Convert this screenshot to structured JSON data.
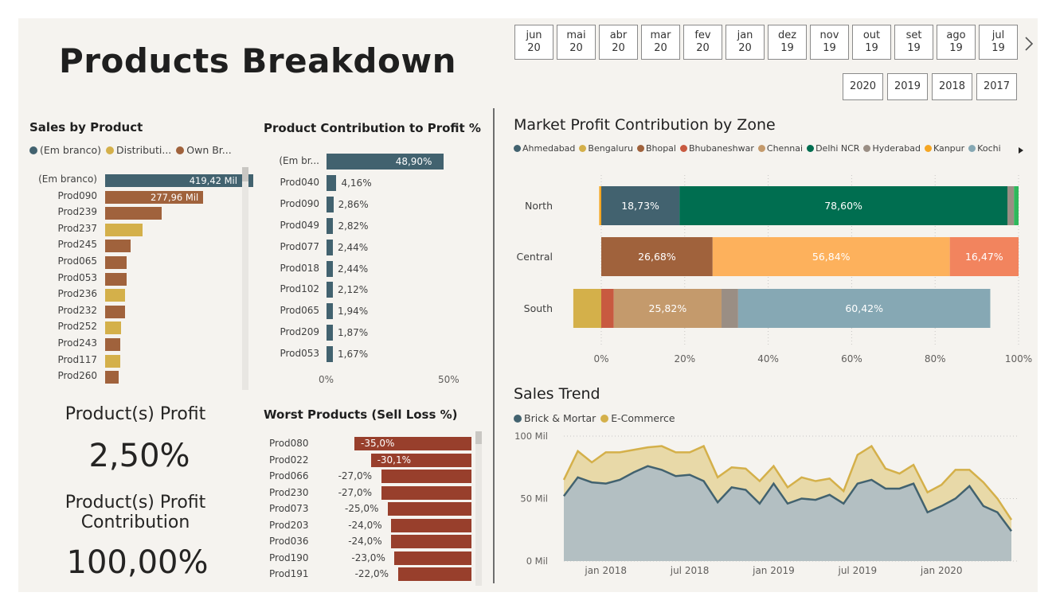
{
  "page_title": "Products Breakdown",
  "month_slicer": [
    {
      "m": "jun",
      "y": "20"
    },
    {
      "m": "mai",
      "y": "20"
    },
    {
      "m": "abr",
      "y": "20"
    },
    {
      "m": "mar",
      "y": "20"
    },
    {
      "m": "fev",
      "y": "20"
    },
    {
      "m": "jan",
      "y": "20"
    },
    {
      "m": "dez",
      "y": "19"
    },
    {
      "m": "nov",
      "y": "19"
    },
    {
      "m": "out",
      "y": "19"
    },
    {
      "m": "set",
      "y": "19"
    },
    {
      "m": "ago",
      "y": "19"
    },
    {
      "m": "jul",
      "y": "19"
    }
  ],
  "year_slicer": [
    "2020",
    "2019",
    "2018",
    "2017"
  ],
  "sales_by_product": {
    "title": "Sales by Product",
    "legend": [
      {
        "label": "(Em branco)",
        "color": "#42626f"
      },
      {
        "label": "Distributi...",
        "color": "#d4b04a"
      },
      {
        "label": "Own Br...",
        "color": "#a0623c"
      }
    ]
  },
  "profit_contribution": {
    "title": "Product Contribution to Profit %"
  },
  "worst_products": {
    "title": "Worst Products (Sell Loss %)"
  },
  "kpi": {
    "profit_label": "Product(s) Profit",
    "profit_value": "2,50%",
    "contribution_label_1": "Product(s) Profit",
    "contribution_label_2": "Contribution",
    "contribution_value": "100,00%"
  },
  "market_zone": {
    "title": "Market Profit Contribution by Zone",
    "legend": [
      {
        "label": "Ahmedabad",
        "color": "#42626f"
      },
      {
        "label": "Bengaluru",
        "color": "#d4b04a"
      },
      {
        "label": "Bhopal",
        "color": "#a0623c"
      },
      {
        "label": "Bhubaneshwar",
        "color": "#c85a40"
      },
      {
        "label": "Chennai",
        "color": "#c49a6c"
      },
      {
        "label": "Delhi NCR",
        "color": "#006e50"
      },
      {
        "label": "Hyderabad",
        "color": "#9a8e84"
      },
      {
        "label": "Kanpur",
        "color": "#f5a623"
      },
      {
        "label": "Kochi",
        "color": "#86a8b4"
      }
    ]
  },
  "sales_trend": {
    "title": "Sales Trend",
    "legend": [
      {
        "label": "Brick & Mortar",
        "color": "#42626f"
      },
      {
        "label": "E-Commerce",
        "color": "#d4b04a"
      }
    ]
  },
  "chart_data": [
    {
      "type": "bar",
      "orientation": "horizontal",
      "title": "Sales by Product",
      "categories": [
        "(Em branco)",
        "Prod090",
        "Prod239",
        "Prod237",
        "Prod245",
        "Prod065",
        "Prod053",
        "Prod236",
        "Prod232",
        "Prod252",
        "Prod243",
        "Prod117",
        "Prod260"
      ],
      "values": [
        419.42,
        277.96,
        160,
        107,
        72,
        62,
        62,
        56,
        56,
        46,
        42,
        42,
        38
      ],
      "groups": [
        "(Em branco)",
        "Own Br...",
        "Own Br...",
        "Distributi...",
        "Own Br...",
        "Own Br...",
        "Own Br...",
        "Distributi...",
        "Own Br...",
        "Distributi...",
        "Own Br...",
        "Distributi...",
        "Own Br..."
      ],
      "data_labels": [
        "419,42 Mil",
        "277,96 Mil",
        "",
        "",
        "",
        "",
        "",
        "",
        "",
        "",
        "",
        "",
        ""
      ],
      "xlim": [
        0,
        600
      ]
    },
    {
      "type": "bar",
      "orientation": "horizontal",
      "title": "Product Contribution to Profit %",
      "categories": [
        "(Em br...",
        "Prod040",
        "Prod090",
        "Prod049",
        "Prod077",
        "Prod018",
        "Prod102",
        "Prod065",
        "Prod209",
        "Prod053"
      ],
      "values": [
        48.9,
        4.16,
        2.86,
        2.82,
        2.44,
        2.44,
        2.12,
        1.94,
        1.87,
        1.67
      ],
      "data_labels": [
        "48,90%",
        "4,16%",
        "2,86%",
        "2,82%",
        "2,44%",
        "2,44%",
        "2,12%",
        "1,94%",
        "1,87%",
        "1,67%"
      ],
      "xticks": [
        "0%",
        "50%"
      ],
      "xlim": [
        0,
        50
      ]
    },
    {
      "type": "bar",
      "orientation": "horizontal",
      "title": "Worst Products (Sell Loss %)",
      "categories": [
        "Prod080",
        "Prod022",
        "Prod066",
        "Prod230",
        "Prod073",
        "Prod203",
        "Prod036",
        "Prod190",
        "Prod191"
      ],
      "values": [
        -35.0,
        -30.1,
        -27.0,
        -27.0,
        -25.0,
        -24.0,
        -24.0,
        -23.0,
        -22.0
      ],
      "data_labels": [
        "-35,0%",
        "-30,1%",
        "-27,0%",
        "-27,0%",
        "-25,0%",
        "-24,0%",
        "-24,0%",
        "-23,0%",
        "-22,0%"
      ]
    },
    {
      "type": "bar",
      "orientation": "horizontal",
      "stacked": true,
      "title": "Market Profit Contribution by Zone",
      "categories": [
        "North",
        "Central",
        "South"
      ],
      "series": [
        {
          "name": "Kanpur",
          "zone": "North",
          "from": -0.5,
          "to": 0,
          "color": "#f5a623",
          "label": ""
        },
        {
          "name": "Ahmedabad",
          "zone": "North",
          "from": 0,
          "to": 18.73,
          "color": "#42626f",
          "label": "18,73%"
        },
        {
          "name": "Delhi NCR",
          "zone": "North",
          "from": 18.73,
          "to": 97.33,
          "color": "#006e50",
          "label": "78,60%"
        },
        {
          "name": "Hyderabad",
          "zone": "North",
          "from": 97.33,
          "to": 98.9,
          "color": "#9a8e84",
          "label": ""
        },
        {
          "name": "Delhi NCR",
          "zone": "North",
          "from": 98.9,
          "to": 100,
          "color": "#2eb85c",
          "label": ""
        },
        {
          "name": "Bhopal",
          "zone": "Central",
          "from": 0,
          "to": 26.68,
          "color": "#a0623c",
          "label": "26,68%"
        },
        {
          "name": "Kanpur",
          "zone": "Central",
          "from": 26.68,
          "to": 83.52,
          "color": "#fdb15c",
          "label": "56,84%"
        },
        {
          "name": "Bhubaneshwar",
          "zone": "Central",
          "from": 83.52,
          "to": 100,
          "color": "#f2845e",
          "label": "16,47%"
        },
        {
          "name": "Bengaluru",
          "zone": "South",
          "from": -6.7,
          "to": 0,
          "color": "#d4b04a",
          "label": ""
        },
        {
          "name": "Bhubaneshwar",
          "zone": "South",
          "from": 0,
          "to": 3.0,
          "color": "#c85a40",
          "label": ""
        },
        {
          "name": "Chennai",
          "zone": "South",
          "from": 3.0,
          "to": 28.82,
          "color": "#c49a6c",
          "label": "25,82%"
        },
        {
          "name": "Hyderabad",
          "zone": "South",
          "from": 28.82,
          "to": 32.8,
          "color": "#9a8e84",
          "label": ""
        },
        {
          "name": "Kochi",
          "zone": "South",
          "from": 32.8,
          "to": 93.22,
          "color": "#86a8b4",
          "label": "60,42%"
        }
      ],
      "xticks": [
        "0%",
        "20%",
        "40%",
        "60%",
        "80%",
        "100%"
      ],
      "xlim": [
        -7,
        100
      ]
    },
    {
      "type": "area",
      "title": "Sales Trend",
      "x": [
        "2017-10",
        "2017-11",
        "2017-12",
        "2018-01",
        "2018-02",
        "2018-03",
        "2018-04",
        "2018-05",
        "2018-06",
        "2018-07",
        "2018-08",
        "2018-09",
        "2018-10",
        "2018-11",
        "2018-12",
        "2019-01",
        "2019-02",
        "2019-03",
        "2019-04",
        "2019-05",
        "2019-06",
        "2019-07",
        "2019-08",
        "2019-09",
        "2019-10",
        "2019-11",
        "2019-12",
        "2020-01",
        "2020-02",
        "2020-03",
        "2020-04",
        "2020-05",
        "2020-06"
      ],
      "series": [
        {
          "name": "Brick & Mortar",
          "values": [
            52,
            67,
            63,
            62,
            65,
            71,
            76,
            73,
            68,
            69,
            64,
            47,
            59,
            57,
            46,
            62,
            46,
            50,
            49,
            53,
            46,
            62,
            65,
            58,
            58,
            62,
            39,
            44,
            50,
            60,
            44,
            39,
            24
          ]
        },
        {
          "name": "E-Commerce",
          "values": [
            65,
            88,
            79,
            87,
            87,
            89,
            91,
            92,
            87,
            87,
            92,
            67,
            75,
            74,
            64,
            76,
            59,
            67,
            64,
            66,
            56,
            85,
            92,
            74,
            70,
            77,
            55,
            61,
            73,
            73,
            63,
            50,
            33
          ]
        }
      ],
      "xticks": [
        "jan 2018",
        "jul 2018",
        "jan 2019",
        "jul 2019",
        "jan 2020"
      ],
      "yticks": [
        "0 Mil",
        "50 Mil",
        "100 Mil"
      ],
      "ylim": [
        0,
        100
      ]
    }
  ]
}
